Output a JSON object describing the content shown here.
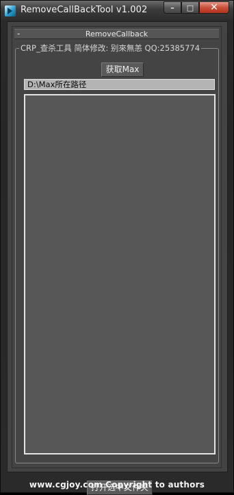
{
  "window": {
    "title": "RemoveCallBackTool v1.002",
    "buttons": {
      "minimize": "–",
      "maximize": "□",
      "close": "✕"
    }
  },
  "rollout": {
    "toggle": "-",
    "title": "RemoveCallback"
  },
  "group": {
    "label": "CRP_查杀工具 简体修改: 别來無恙 QQ:25385774"
  },
  "buttons": {
    "get_max": "获取Max",
    "open_folder": "打开选中文件夹"
  },
  "path_field": {
    "value": "D:\\Max所在路径"
  },
  "listbox": {
    "items": []
  },
  "footer": {
    "text": "www.cgjoy.com  Copyright to authors"
  }
}
